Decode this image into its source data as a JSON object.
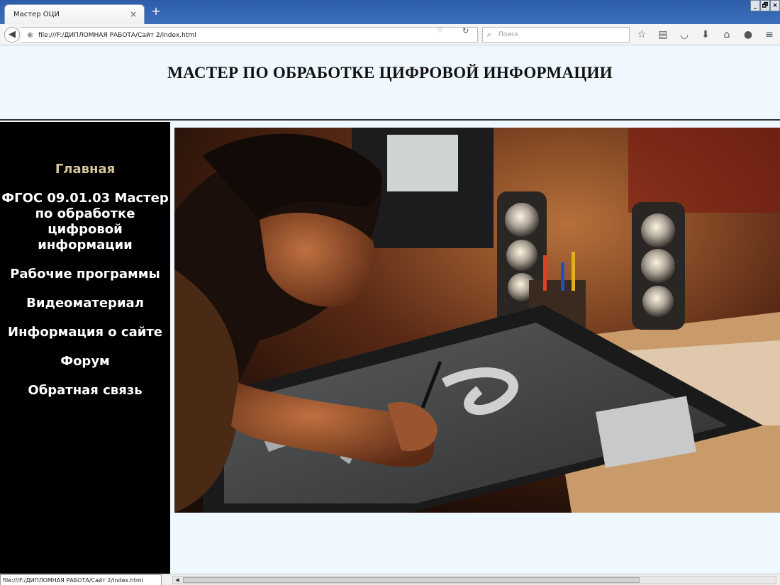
{
  "browser": {
    "tab_title": "Мастер ОЦИ",
    "tab_close": "×",
    "new_tab": "+",
    "window_buttons": [
      "_",
      "🗗",
      "×"
    ],
    "url": "file:///F:/ДИПЛОМНАЯ РАБОТА/Сайт 2/index.html",
    "search_placeholder": "Поиск",
    "status_url": "file:///F:/ДИПЛОМНАЯ РАБОТА/Сайт 2/index.html",
    "toolbar_icons": [
      "star-icon",
      "reading-list-icon",
      "pocket-icon",
      "download-icon",
      "home-icon",
      "chat-icon",
      "menu-icon"
    ]
  },
  "site": {
    "title": "МАСТЕР ПО ОБРАБОТКЕ ЦИФРОВОЙ ИНФОРМАЦИИ"
  },
  "menu": {
    "items": [
      {
        "label": "Главная",
        "active": true
      },
      {
        "label": "ФГОС 09.01.03 Мастер по обработке цифровой информации",
        "active": false
      },
      {
        "label": "Рабочие программы",
        "active": false
      },
      {
        "label": "Видеоматериал",
        "active": false
      },
      {
        "label": "Информация о сайте",
        "active": false
      },
      {
        "label": "Форум",
        "active": false
      },
      {
        "label": "Обратная связь",
        "active": false
      }
    ]
  },
  "colors": {
    "page_background": "#f0f8ff",
    "sidebar_background": "#000000",
    "active_menu": "#d8c69b",
    "menu_text": "#ffffff"
  }
}
